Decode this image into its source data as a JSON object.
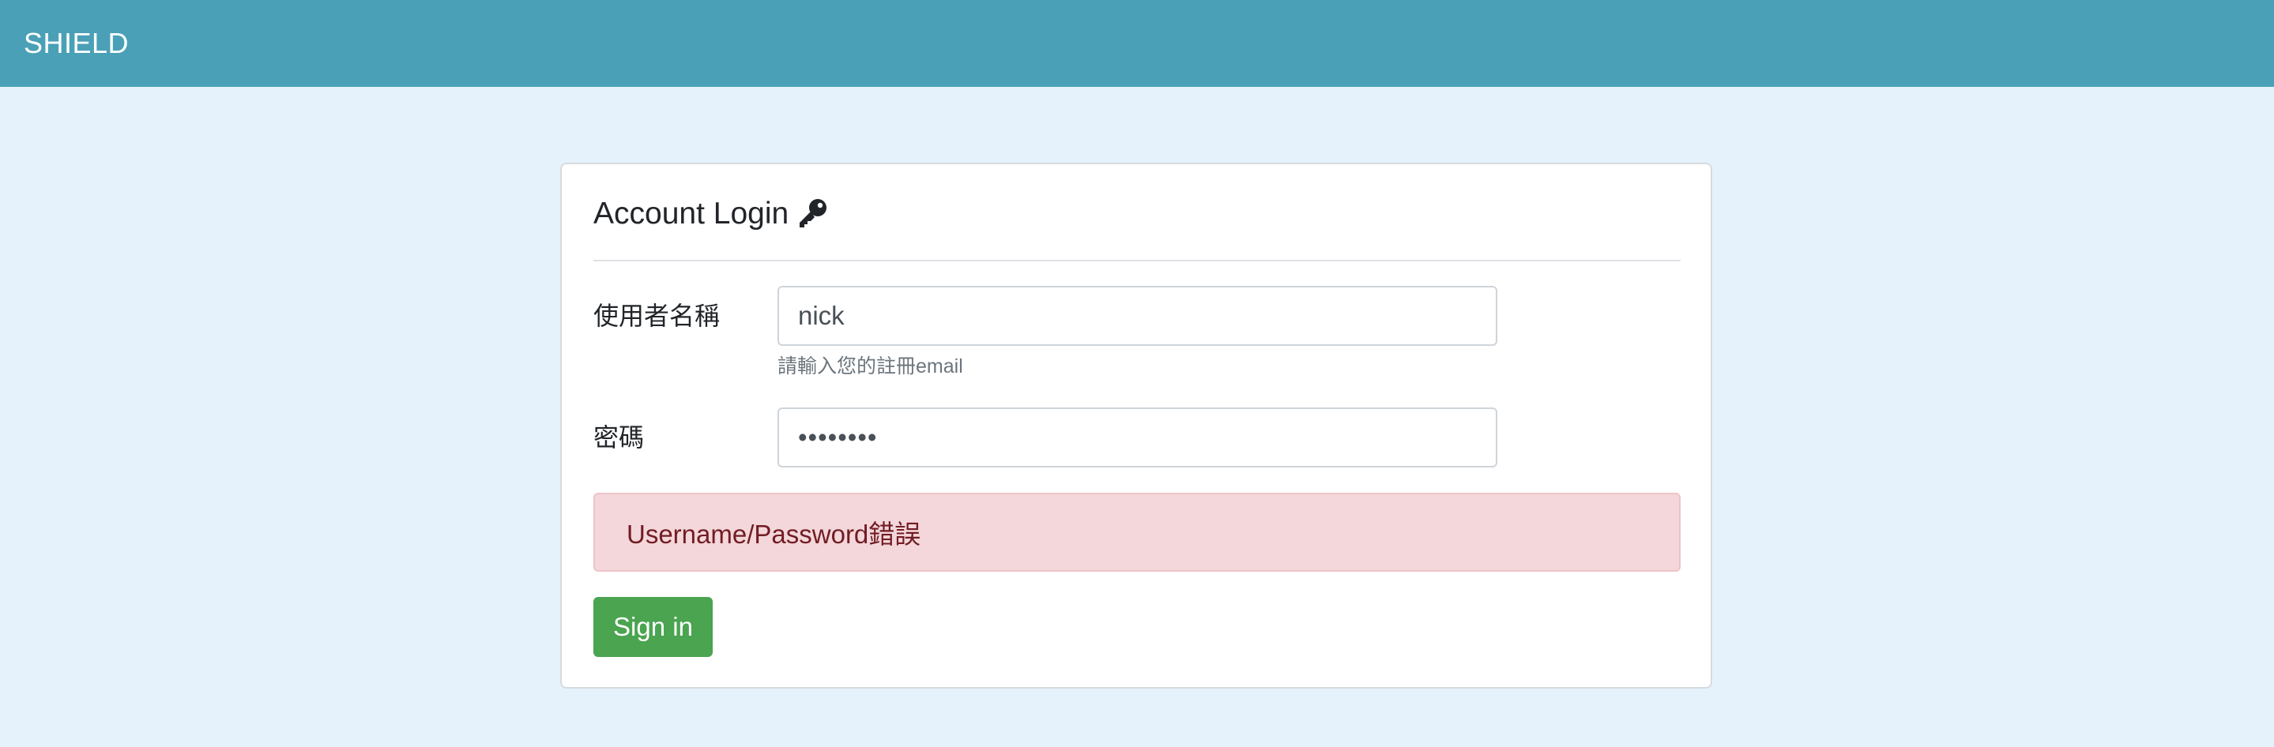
{
  "navbar": {
    "brand": "SHIELD",
    "color": "#4aa0b7"
  },
  "page": {
    "background": "#e5f2fb"
  },
  "login_card": {
    "title": "Account Login",
    "title_icon": "key-icon",
    "username": {
      "label": "使用者名稱",
      "value": "nick",
      "help_text": "請輸入您的註冊email"
    },
    "password": {
      "label": "密碼",
      "value": "••••••••"
    },
    "error_alert": {
      "message": "Username/Password錯誤",
      "color": "#721c24",
      "background": "#f3d7da"
    },
    "submit": {
      "label": "Sign in",
      "color": "#4aa450"
    }
  }
}
